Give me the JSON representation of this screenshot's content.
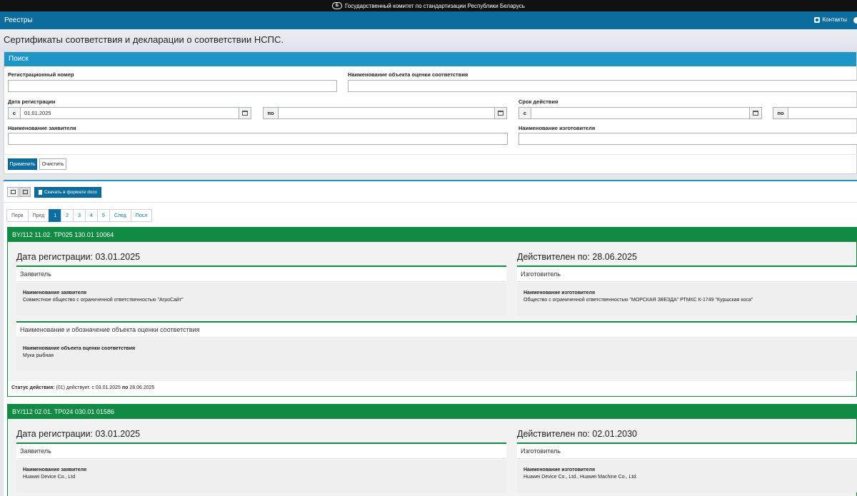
{
  "topbar": {
    "logo": "Б",
    "text": "Государственный комитет по стандартизации Республики Беларусь"
  },
  "navbar": {
    "brand": "Реестры",
    "contacts": "Контакты"
  },
  "page": {
    "title": "Сертификаты соответствия и декларации о соответствии НСПС."
  },
  "search": {
    "header": "Поиск",
    "reg_number_label": "Регистрационный номер",
    "object_name_label": "Наименование объекта оценки соответствия",
    "reg_date_label": "Дата регистрации",
    "validity_label": "Срок действия",
    "from": "с",
    "to": "по",
    "reg_date_from_value": "01.01.2025",
    "applicant_label": "Наименование заявителя",
    "manufacturer_label": "Наименование изготовителя",
    "apply_label": "Применить",
    "clear_label": "Очистить"
  },
  "results": {
    "download_label": "Скачать в формате docx",
    "pager": {
      "first": "Перв",
      "prev": "Пред",
      "pages": [
        "1",
        "2",
        "3",
        "4",
        "5"
      ],
      "next": "След",
      "last": "Посл"
    },
    "cards": [
      {
        "number": "BY/112 11.02. ТР025 130.01 10064",
        "reg_date": "Дата регистрации: 03.01.2025",
        "valid_until": "Действителен по: 28.06.2025",
        "applicant_title": "Заявитель",
        "applicant_label": "Наименование заявителя",
        "applicant_value": "Совместное общество с ограниченной ответственностью \"АгроСайт\"",
        "manufacturer_title": "Изготовитель",
        "manufacturer_label": "Наименование изготовителя",
        "manufacturer_value": "Общество с ограниченной ответственностью \"МОРСКАЯ ЗВЕЗДА\" РТМКС К-1749 \"Куршская коса\"",
        "object_title": "Наименование и обозначение объекта оценки соответствия",
        "object_label": "Наименование объекта оценки соответствия",
        "object_value": "Мука рыбная",
        "status_label": "Статус действия:",
        "status_value": "(01) действует.",
        "status_from": "с 03.01.2025",
        "status_to_label": "по",
        "status_to": "28.06.2025"
      },
      {
        "number": "BY/112 02.01. ТР024 030.01 01586",
        "reg_date": "Дата регистрации: 03.01.2025",
        "valid_until": "Действителен по: 02.01.2030",
        "applicant_title": "Заявитель",
        "applicant_label": "Наименование заявителя",
        "applicant_value": "Huawei Device Co., Ltd",
        "manufacturer_title": "Изготовитель",
        "manufacturer_label": "Наименование изготовителя",
        "manufacturer_value": "Huawei Device Co., Ltd., Huawei Machine Co., Ltd."
      }
    ]
  }
}
